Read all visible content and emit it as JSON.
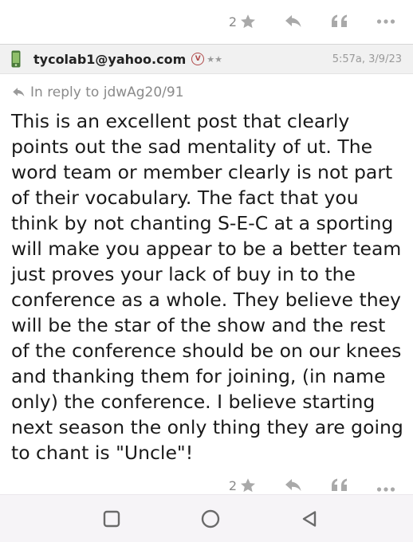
{
  "top_actions": {
    "rec_count": "2",
    "star_icon": "star-icon",
    "reply_icon": "reply-arrow-icon",
    "quote_icon": "quote-icon",
    "more_icon": "more-dots-icon"
  },
  "message": {
    "author": "tycolab1@yahoo.com",
    "verified_badge": "V",
    "rating_stars": "★★",
    "timestamp": "5:57a, 3/9/23",
    "reply_to": "In reply to jdwAg20/91",
    "body": "This is an excellent post that clearly points out the sad mentality of ut. The word team or member clearly is not part of their vocabulary. The fact that you think by not chanting S-E-C at a sporting will make you appear to be a better team just proves your lack of buy in to the conference as a whole. They believe they will be the star of the show and the rest of the conference should be on our knees and thanking them for joining, (in name only) the conference. I believe starting next season the only thing they are going to chant is \"Uncle\"!"
  },
  "bottom_actions": {
    "rec_count": "2"
  },
  "nav_bar": {
    "buttons": [
      "recent-apps",
      "home",
      "back"
    ]
  },
  "colors": {
    "header_bg": "#f1f1f1",
    "icon_gray": "#9a9a9a",
    "badge_red": "#b04a4a",
    "phone_green": "#4a7a3a",
    "nav_bg": "#f6f4f7"
  }
}
